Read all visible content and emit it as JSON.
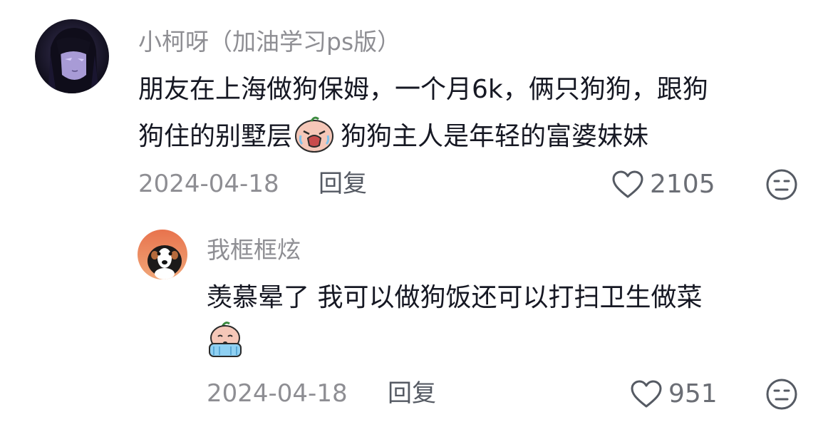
{
  "comments": [
    {
      "username": "小柯呀（加油学习ps版）",
      "lines": [
        "朋友在上海做狗保姆，一个月6k，俩只狗狗，跟狗",
        "狗住的别墅层",
        "狗狗主人是年轻的富婆妹妹"
      ],
      "emoji_name": "crying-peach-emoji",
      "date": "2024-04-18",
      "reply_label": "回复",
      "likes": "2105",
      "avatar_icon": "anime-girl-avatar"
    },
    {
      "username": "我框框炫",
      "lines": [
        "羡慕晕了 我可以做狗饭还可以打扫卫生做菜"
      ],
      "emoji_name": "tearful-peach-emoji",
      "date": "2024-04-18",
      "reply_label": "回复",
      "likes": "951",
      "avatar_icon": "dog-avatar"
    }
  ],
  "colors": {
    "username": "#8e8e93",
    "content": "#161823",
    "meta": "#8e8e93",
    "icon": "#555a63"
  }
}
